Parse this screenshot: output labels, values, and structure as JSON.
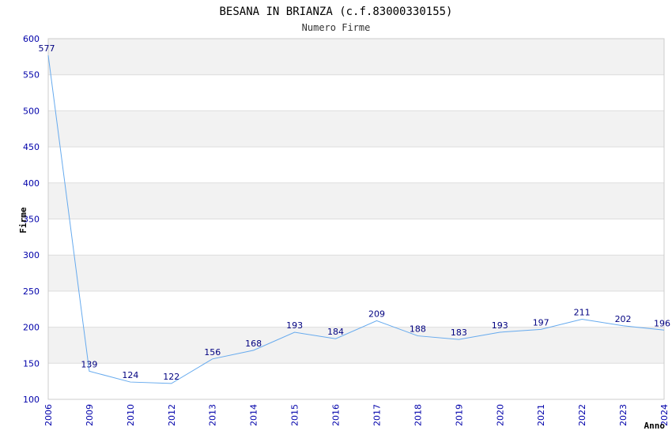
{
  "chart_data": {
    "type": "line",
    "title": "BESANA IN BRIANZA (c.f.83000330155)",
    "subtitle": "Numero Firme",
    "xlabel": "Anno",
    "ylabel": "Firme",
    "categories": [
      "2006",
      "2009",
      "2010",
      "2012",
      "2013",
      "2014",
      "2015",
      "2016",
      "2017",
      "2018",
      "2019",
      "2020",
      "2021",
      "2022",
      "2023",
      "2024"
    ],
    "series": [
      {
        "values": [
          577,
          139,
          124,
          122,
          156,
          168,
          193,
          184,
          209,
          188,
          183,
          193,
          197,
          211,
          202,
          196
        ]
      }
    ],
    "ylim": [
      100,
      600
    ],
    "yticks": [
      100,
      150,
      200,
      250,
      300,
      350,
      400,
      450,
      500,
      550,
      600
    ],
    "grid": true,
    "colors": {
      "line": "#66aaee",
      "band": "#f2f2f2",
      "grid": "#dddddd",
      "tick": "#0000aa",
      "label": "#000080"
    }
  }
}
